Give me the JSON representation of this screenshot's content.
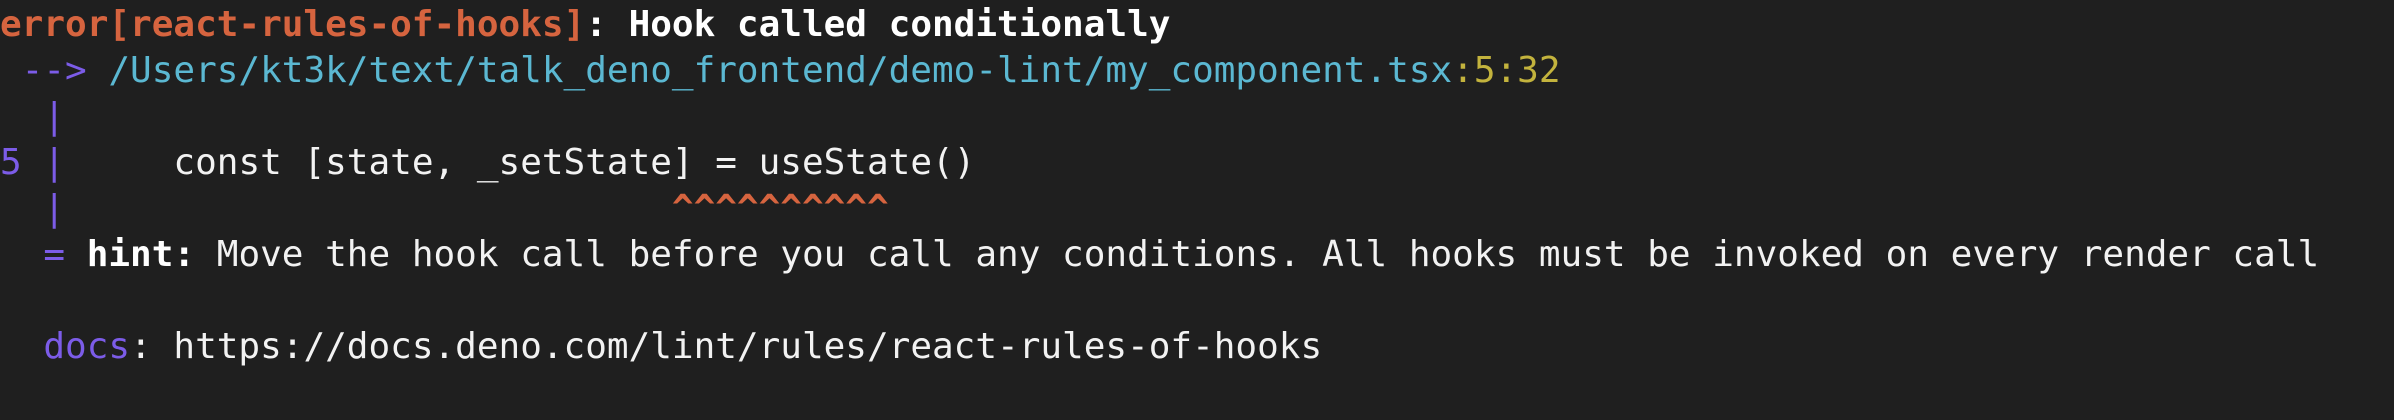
{
  "diagnostic": {
    "error_prefix": "error[react-rules-of-hooks]",
    "error_colon": ":",
    "error_message": " Hook called conditionally",
    "location_arrow": " -->",
    "location_path": " /Users/kt3k/text/talk_deno_frontend/demo-lint/my_component.tsx",
    "location_line_col": ":5:32",
    "gutter_bar": "  |",
    "line_number": "5",
    "line_bar": " |",
    "source_code": "     const [state, _setState] = useState()",
    "caret_gutter": "  |",
    "caret_padding": "                            ",
    "caret_marks": "^^^^^^^^^^",
    "hint_eq": "  =",
    "hint_label": " hint",
    "hint_colon": ":",
    "hint_text": " Move the hook call before you call any conditions. All hooks must be invoked on every render call",
    "docs_label": "  docs",
    "docs_colon": ":",
    "docs_url": " https://docs.deno.com/lint/rules/react-rules-of-hooks"
  },
  "colors": {
    "background": "#1f1f1f",
    "error": "#d6643f",
    "gutter": "#7c5ce8",
    "path": "#5bb8d2",
    "line_col": "#c3b33d",
    "text": "#f2f2f2"
  }
}
